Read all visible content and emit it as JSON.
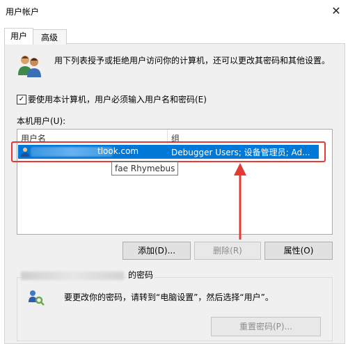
{
  "window": {
    "title": "用户帐户",
    "close_glyph": "✕"
  },
  "tabs": [
    {
      "label": "用户",
      "selected": true
    },
    {
      "label": "高级",
      "selected": false
    }
  ],
  "users_page": {
    "description": "用下列表授予或拒绝用户访问你的计算机，还可以更改其密码和其他设置。",
    "require_login_checkbox": {
      "label": "要使用本计算机，用户必须输入用户名和密码(E)",
      "checked": true,
      "check_glyph": "✓"
    },
    "list_label": "本机用户(U):",
    "columns": [
      "用户名",
      "组"
    ],
    "rows": [
      {
        "username_visible": "tlook.com",
        "group": "Debugger Users; 设备管理员; Ad...",
        "selected": true
      }
    ],
    "tooltip": "fae Rhymebus",
    "buttons": {
      "add": "添加(D)...",
      "remove": "删除(R)",
      "properties": "属性(O)"
    }
  },
  "password_section": {
    "title_suffix": "的密码",
    "description": "要更改你的密码，请转到“电脑设置”，然后选择“用户”。",
    "reset_button": "重置密码(P)..."
  },
  "colors": {
    "selection": "#0078d7",
    "annotation_red": "#e53935",
    "panel_bg": "#f0f0f0"
  }
}
